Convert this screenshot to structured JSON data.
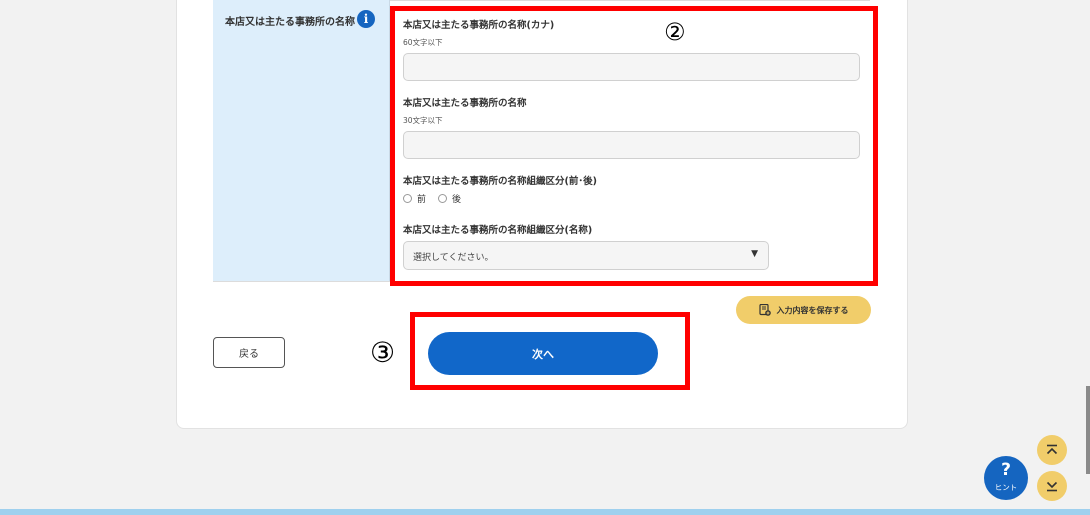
{
  "row": {
    "label": "本店又は主たる事務所の名称",
    "info_icon": "i"
  },
  "fields": {
    "kana_label": "本店又は主たる事務所の名称(カナ)",
    "kana_hint": "60文字以下",
    "kana_value": "",
    "name_label": "本店又は主たる事務所の名称",
    "name_hint": "30文字以下",
    "name_value": "",
    "org_position_label": "本店又は主たる事務所の名称組織区分(前･後)",
    "radio_options": [
      "前",
      "後"
    ],
    "org_name_label": "本店又は主たる事務所の名称組織区分(名称)",
    "org_name_selected": "選択してください。",
    "select_arrow": "▼"
  },
  "annotations": {
    "marker_2": "②",
    "marker_3": "③"
  },
  "buttons": {
    "save_label": "入力内容を保存する",
    "back_label": "戻る",
    "next_label": "次へ"
  },
  "floating": {
    "hint_symbol": "?",
    "hint_label": "ヒント"
  },
  "colors": {
    "accent_blue": "#1167c9",
    "highlight_red": "#ff0000",
    "yellow": "#f1cd6a",
    "label_bg": "#ddeefb"
  },
  "icons": {
    "info": "info-icon",
    "save": "save-document-icon",
    "scroll_top": "chevron-up-bar-icon",
    "scroll_bottom": "chevron-down-bar-icon"
  }
}
